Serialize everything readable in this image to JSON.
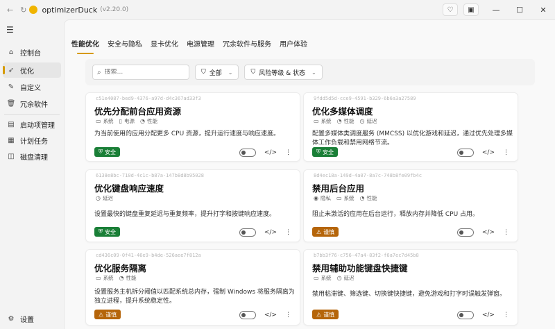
{
  "app": {
    "name": "optimizerDuck",
    "version": "(v2.20.0)"
  },
  "titlebar_icons": [
    "heart-icon",
    "briefcase-icon"
  ],
  "sidebar": {
    "items": [
      {
        "label": "控制台",
        "icon": "home-icon",
        "active": false
      },
      {
        "label": "优化",
        "icon": "rocket-icon",
        "active": true
      },
      {
        "label": "自定义",
        "icon": "wand-icon",
        "active": false
      },
      {
        "label": "冗余软件",
        "icon": "trash-icon",
        "active": false
      },
      {
        "label": "启动项管理",
        "icon": "startup-icon",
        "active": false
      },
      {
        "label": "计划任务",
        "icon": "calendar-icon",
        "active": false
      },
      {
        "label": "磁盘清理",
        "icon": "disk-icon",
        "active": false
      }
    ],
    "settings_label": "设置"
  },
  "tabs": [
    "性能优化",
    "安全与隐私",
    "显卡优化",
    "电源管理",
    "冗余软件与服务",
    "用户体验"
  ],
  "active_tab": 0,
  "filters": {
    "search_placeholder": "搜索...",
    "category": "全部",
    "risk_label": "风险等级 & 状态"
  },
  "colors": {
    "accent": "#d69a00",
    "safe": "#1a7f37",
    "caution": "#b5650a"
  },
  "cards": [
    {
      "id": "c51e4087-bed9-4376-a97d-d4c367ad33f3",
      "title": "优先分配前台应用资源",
      "tags": [
        {
          "icon": "monitor-icon",
          "label": "系统"
        },
        {
          "icon": "battery-icon",
          "label": "电源"
        },
        {
          "icon": "gauge-icon",
          "label": "性能"
        }
      ],
      "description": "为当前使用的应用分配更多 CPU 资源，提升运行速度与响应速度。",
      "risk": "安全",
      "risk_level": "safe"
    },
    {
      "id": "9fdd5d5d-cce9-4591-b329-6b6a3a27589",
      "title": "优化多媒体调度",
      "tags": [
        {
          "icon": "monitor-icon",
          "label": "系统"
        },
        {
          "icon": "gauge-icon",
          "label": "性能"
        },
        {
          "icon": "clock-icon",
          "label": "延迟"
        }
      ],
      "description": "配置多媒体类调度服务 (MMCSS) 以优化游戏和延迟，通过优先处理多媒体工作负载和禁用网络节流。",
      "risk": "安全",
      "risk_level": "safe"
    },
    {
      "id": "6138e8bc-710d-4c1c-b87a-147b8d8b95028",
      "title": "优化键盘响应速度",
      "tags": [
        {
          "icon": "clock-icon",
          "label": "延迟"
        }
      ],
      "description": "设置最快的键盘重复延迟与重复频率，提升打字和按键响应速度。",
      "risk": "安全",
      "risk_level": "safe"
    },
    {
      "id": "8d4ec18a-149d-4a07-8a7c-748b8fe09fb4c",
      "title": "禁用后台应用",
      "tags": [
        {
          "icon": "privacy-icon",
          "label": "隐私"
        },
        {
          "icon": "monitor-icon",
          "label": "系统"
        },
        {
          "icon": "gauge-icon",
          "label": "性能"
        }
      ],
      "description": "阻止未激活的应用在后台运行，释放内存并降低 CPU 占用。",
      "risk": "谨慎",
      "risk_level": "caution"
    },
    {
      "id": "cd436c09-0f41-46e9-b4de-526aee7f812a",
      "title": "优化服务隔离",
      "tags": [
        {
          "icon": "monitor-icon",
          "label": "系统"
        },
        {
          "icon": "gauge-icon",
          "label": "性能"
        }
      ],
      "description": "设置服务主机拆分阈值以匹配系统总内存，强制 Windows 将服务隔离为独立进程，提升系统稳定性。",
      "risk": "谨慎",
      "risk_level": "caution"
    },
    {
      "id": "b7bb3f76-c756-47a4-83f2-f6a7ec7d45b8",
      "title": "禁用辅助功能键盘快捷键",
      "tags": [
        {
          "icon": "monitor-icon",
          "label": "系统"
        },
        {
          "icon": "clock-icon",
          "label": "延迟"
        }
      ],
      "description": "禁用粘滞键、筛选键、切换键快捷键，避免游戏和打字时误触发弹窗。",
      "risk": "谨慎",
      "risk_level": "caution"
    }
  ]
}
